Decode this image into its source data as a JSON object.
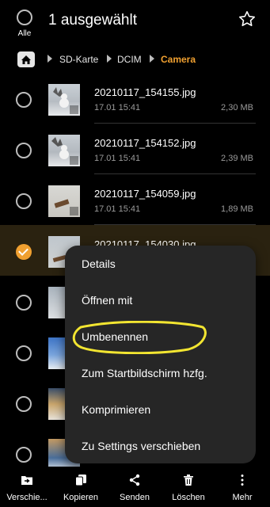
{
  "header": {
    "select_all_label": "Alle",
    "title": "1 ausgewählt"
  },
  "breadcrumb": {
    "items": [
      "SD-Karte",
      "DCIM",
      "Camera"
    ]
  },
  "colors": {
    "accent": "#f0a030",
    "background": "#000000",
    "menu_background": "#262626",
    "highlight_ring": "#f2e531"
  },
  "files": [
    {
      "name": "20210117_154155.jpg",
      "date": "17.01 15:41",
      "size": "2,30 MB",
      "selected": false
    },
    {
      "name": "20210117_154152.jpg",
      "date": "17.01 15:41",
      "size": "2,39 MB",
      "selected": false
    },
    {
      "name": "20210117_154059.jpg",
      "date": "17.01 15:41",
      "size": "1,89 MB",
      "selected": false
    },
    {
      "name": "20210117_154030.jpg",
      "date": "",
      "size": "",
      "selected": true
    },
    {
      "name": "",
      "date": "",
      "size": "",
      "selected": false
    },
    {
      "name": "",
      "date": "",
      "size": "",
      "selected": false
    },
    {
      "name": "",
      "date": "",
      "size": "",
      "selected": false
    },
    {
      "name": "",
      "date": "",
      "size": "",
      "selected": false
    }
  ],
  "context_menu": {
    "items": [
      "Details",
      "Öffnen mit",
      "Umbenennen",
      "Zum Startbildschirm hzfg.",
      "Komprimieren",
      "Zu Settings verschieben"
    ]
  },
  "bottom_actions": [
    {
      "label": "Verschie...",
      "icon": "move-icon"
    },
    {
      "label": "Kopieren",
      "icon": "copy-icon"
    },
    {
      "label": "Senden",
      "icon": "share-icon"
    },
    {
      "label": "Löschen",
      "icon": "delete-icon"
    },
    {
      "label": "Mehr",
      "icon": "more-icon"
    }
  ]
}
